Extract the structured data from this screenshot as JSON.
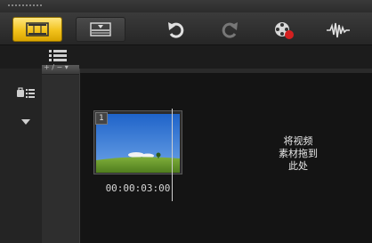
{
  "toolbar": {
    "buttons": [
      {
        "name": "storyboard-view",
        "icon": "filmstrip-icon",
        "active": true,
        "color": "#f2c21c"
      },
      {
        "name": "timeline-view",
        "icon": "timeline-icon",
        "active": false
      },
      {
        "name": "undo",
        "icon": "undo-icon"
      },
      {
        "name": "redo",
        "icon": "redo-icon"
      },
      {
        "name": "record-capture",
        "icon": "film-reel-record-icon"
      },
      {
        "name": "audio-mix",
        "icon": "audio-waveform-icon"
      }
    ]
  },
  "track_header": {
    "zoom_label": "+ / − ▾"
  },
  "storyboard": {
    "clip": {
      "index": "1",
      "timecode": "00:00:03:00"
    },
    "drop_hint": "将视频\n素材拖到\n此处"
  },
  "colors": {
    "accent": "#f2c21c",
    "background": "#141414"
  }
}
